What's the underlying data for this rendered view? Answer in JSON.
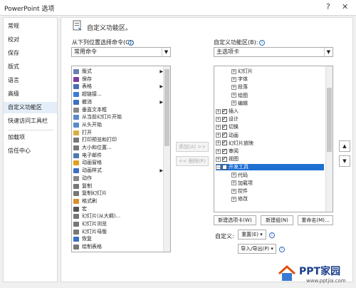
{
  "window": {
    "title": "PowerPoint 选项",
    "help_glyph": "?",
    "close_glyph": "✕"
  },
  "nav": {
    "items": [
      "常规",
      "校对",
      "保存",
      "版式",
      "语言",
      "高级",
      "自定义功能区",
      "快速访问工具栏",
      "加载项",
      "信任中心"
    ],
    "active": "自定义功能区"
  },
  "main": {
    "heading": "自定义功能区。",
    "choose_label": "从下列位置选择命令(C):",
    "choose_value": "常用命令",
    "customize_label": "自定义功能区(B):",
    "customize_value": "主选项卡",
    "info_glyph": "i"
  },
  "commands": [
    {
      "label": "版式",
      "icon": "layout-icon",
      "color": "#6a7fb5",
      "submenu": true
    },
    {
      "label": "保存",
      "icon": "save-icon",
      "color": "#7b3fa0",
      "submenu": false
    },
    {
      "label": "表格",
      "icon": "table-icon",
      "color": "#4a6fb0",
      "submenu": true
    },
    {
      "label": "超链接...",
      "icon": "hyperlink-icon",
      "color": "#3a7bd5",
      "submenu": false
    },
    {
      "label": "撤消",
      "icon": "undo-icon",
      "color": "#3a6fc0",
      "submenu": true
    },
    {
      "label": "垂直文本框",
      "icon": "vertical-textbox-icon",
      "color": "#888888",
      "submenu": false
    },
    {
      "label": "从当前幻灯片开始",
      "icon": "play-current-icon",
      "color": "#5a8ac8",
      "submenu": false
    },
    {
      "label": "从头开始",
      "icon": "play-start-icon",
      "color": "#5a8ac8",
      "submenu": false
    },
    {
      "label": "打开",
      "icon": "open-icon",
      "color": "#d8b040",
      "submenu": false
    },
    {
      "label": "打印预览和打印",
      "icon": "print-preview-icon",
      "color": "#777777",
      "submenu": false
    },
    {
      "label": "大小和位置...",
      "icon": "size-position-icon",
      "color": "#777777",
      "submenu": false
    },
    {
      "label": "电子邮件",
      "icon": "email-icon",
      "color": "#4a7ab0",
      "submenu": false
    },
    {
      "label": "动画窗格",
      "icon": "animation-pane-icon",
      "color": "#e0a020",
      "submenu": false
    },
    {
      "label": "动画样式",
      "icon": "animation-style-icon",
      "color": "#3a6fc0",
      "submenu": true
    },
    {
      "label": "动作",
      "icon": "action-icon",
      "color": "#888888",
      "submenu": false
    },
    {
      "label": "复制",
      "icon": "copy-icon",
      "color": "#777777",
      "submenu": false
    },
    {
      "label": "复制幻灯片",
      "icon": "duplicate-slide-icon",
      "color": "#777777",
      "submenu": false
    },
    {
      "label": "格式刷",
      "icon": "format-painter-icon",
      "color": "#d89030",
      "submenu": false
    },
    {
      "label": "宏",
      "icon": "macro-icon",
      "color": "#555555",
      "submenu": false
    },
    {
      "label": "幻灯片(从大纲)...",
      "icon": "slides-from-outline-icon",
      "color": "#777777",
      "submenu": false
    },
    {
      "label": "幻灯片浏览",
      "icon": "slide-sorter-icon",
      "color": "#777777",
      "submenu": false
    },
    {
      "label": "幻灯片母版",
      "icon": "slide-master-icon",
      "color": "#777777",
      "submenu": false
    },
    {
      "label": "恢复",
      "icon": "redo-icon",
      "color": "#3a6fc0",
      "submenu": false
    },
    {
      "label": "绘制表格",
      "icon": "draw-table-icon",
      "color": "#777777",
      "submenu": false
    }
  ],
  "ribbon_tree": [
    {
      "label": "幻灯片",
      "level": 2,
      "expand": "+",
      "checkbox": false,
      "selected": false
    },
    {
      "label": "字体",
      "level": 2,
      "expand": "+",
      "checkbox": false,
      "selected": false
    },
    {
      "label": "段落",
      "level": 2,
      "expand": "+",
      "checkbox": false,
      "selected": false
    },
    {
      "label": "绘图",
      "level": 2,
      "expand": "+",
      "checkbox": false,
      "selected": false
    },
    {
      "label": "编辑",
      "level": 2,
      "expand": "+",
      "checkbox": false,
      "selected": false
    },
    {
      "label": "插入",
      "level": 1,
      "expand": "+",
      "checkbox": true,
      "selected": false
    },
    {
      "label": "设计",
      "level": 1,
      "expand": "+",
      "checkbox": true,
      "selected": false
    },
    {
      "label": "切换",
      "level": 1,
      "expand": "+",
      "checkbox": true,
      "selected": false
    },
    {
      "label": "动画",
      "level": 1,
      "expand": "+",
      "checkbox": true,
      "selected": false
    },
    {
      "label": "幻灯片放映",
      "level": 1,
      "expand": "+",
      "checkbox": true,
      "selected": false
    },
    {
      "label": "审阅",
      "level": 1,
      "expand": "+",
      "checkbox": true,
      "selected": false
    },
    {
      "label": "视图",
      "level": 1,
      "expand": "+",
      "checkbox": true,
      "selected": false
    },
    {
      "label": "开发工具",
      "level": 1,
      "expand": "−",
      "checkbox": true,
      "selected": true
    },
    {
      "label": "代码",
      "level": 2,
      "expand": "+",
      "checkbox": false,
      "selected": false
    },
    {
      "label": "加载项",
      "level": 2,
      "expand": "+",
      "checkbox": false,
      "selected": false
    },
    {
      "label": "控件",
      "level": 2,
      "expand": "+",
      "checkbox": false,
      "selected": false
    },
    {
      "label": "修改",
      "level": 2,
      "expand": "+",
      "checkbox": false,
      "selected": false
    }
  ],
  "buttons": {
    "add": "添加(A) >>",
    "remove": "<< 删除(R)",
    "move_up": "▲",
    "move_down": "▼",
    "new_tab": "新建选项卡(W)",
    "new_group": "新建组(N)",
    "rename": "重命名(M)...",
    "customize_label": "自定义:",
    "reset": "重置(E) ▾",
    "import_export": "导入/导出(P) ▾"
  },
  "watermark": {
    "brand": "PPT家园",
    "url": "www.pptjia.com"
  }
}
